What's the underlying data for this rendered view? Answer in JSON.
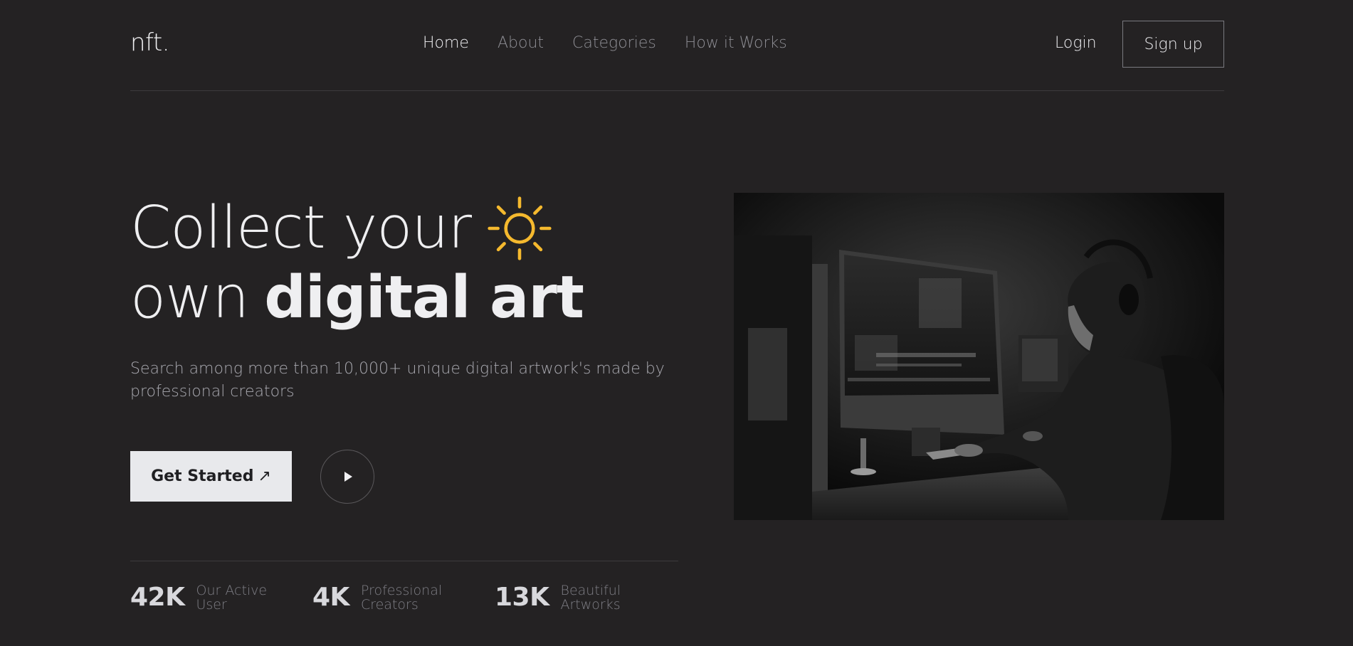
{
  "header": {
    "logo": "nft.",
    "nav": [
      {
        "label": "Home",
        "active": true
      },
      {
        "label": "About",
        "active": false
      },
      {
        "label": "Categories",
        "active": false
      },
      {
        "label": "How it Works",
        "active": false
      }
    ],
    "login_label": "Login",
    "signup_label": "Sign up"
  },
  "hero": {
    "headline_line1": "Collect your",
    "headline_line2_light": "own",
    "headline_line2_bold": "digital art",
    "headline_icon": "sun-icon",
    "subtitle": "Search among more than 10,000+ unique digital artwork's made by professional creators",
    "cta_label": "Get Started",
    "cta_icon": "arrow-up-right-icon",
    "cta_arrow": "↗",
    "play_icon": "play-icon",
    "accent_color": "#f5b92e",
    "image_icon": "person-at-computer-photo"
  },
  "stats": [
    {
      "value": "42K",
      "label_line1": "Our Active",
      "label_line2": "User"
    },
    {
      "value": "4K",
      "label_line1": "Professional",
      "label_line2": "Creators"
    },
    {
      "value": "13K",
      "label_line1": "Beautiful",
      "label_line2": "Artworks"
    }
  ],
  "colors": {
    "background": "#242223",
    "text_primary": "#efeff1",
    "text_muted": "#8d8d93",
    "button_bg": "#e8e9ec"
  }
}
